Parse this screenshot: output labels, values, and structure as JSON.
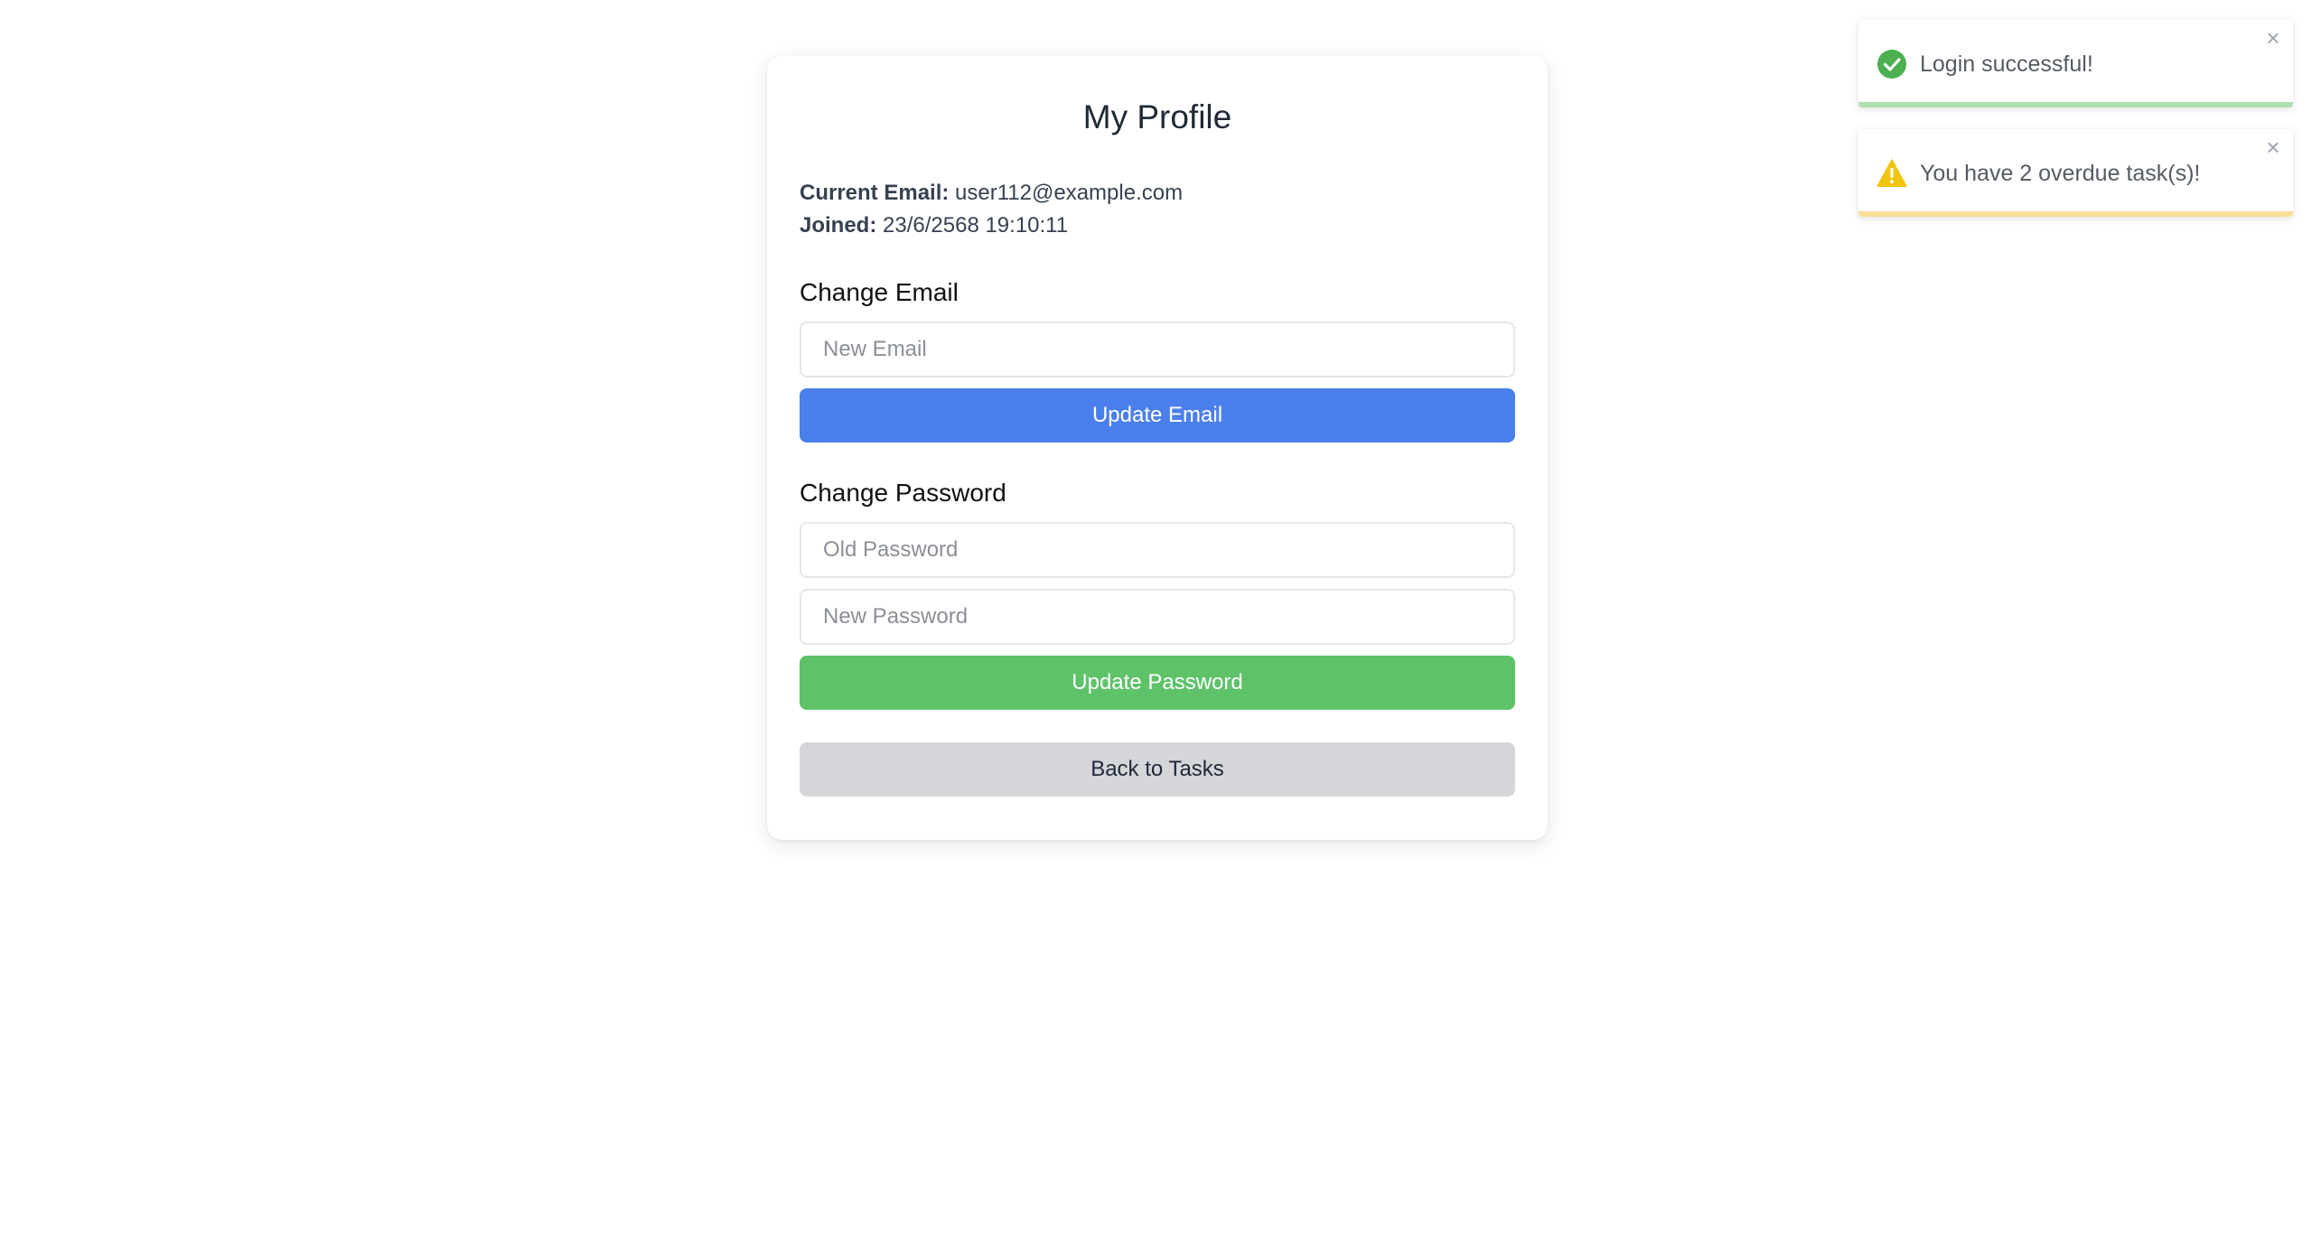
{
  "profile": {
    "title": "My Profile",
    "current_email_label": "Current Email:",
    "current_email_value": "user112@example.com",
    "joined_label": "Joined:",
    "joined_value": "23/6/2568 19:10:11"
  },
  "change_email": {
    "heading": "Change Email",
    "new_email_placeholder": "New Email",
    "new_email_value": "",
    "submit_label": "Update Email"
  },
  "change_password": {
    "heading": "Change Password",
    "old_password_placeholder": "Old Password",
    "new_password_placeholder": "New Password",
    "submit_label": "Update Password"
  },
  "back_label": "Back to Tasks",
  "toasts": [
    {
      "type": "success",
      "icon": "check-circle-icon",
      "message": "Login successful!",
      "close_glyph": "×",
      "color": "#4caf50",
      "progress": 1.0
    },
    {
      "type": "warning",
      "icon": "warning-triangle-icon",
      "message": "You have 2 overdue task(s)!",
      "close_glyph": "×",
      "color": "#f1c40f",
      "progress": 1.0
    }
  ],
  "colors": {
    "primary_button": "#4b80ec",
    "success_button": "#5ec269",
    "secondary_button": "#d4d6d9"
  }
}
